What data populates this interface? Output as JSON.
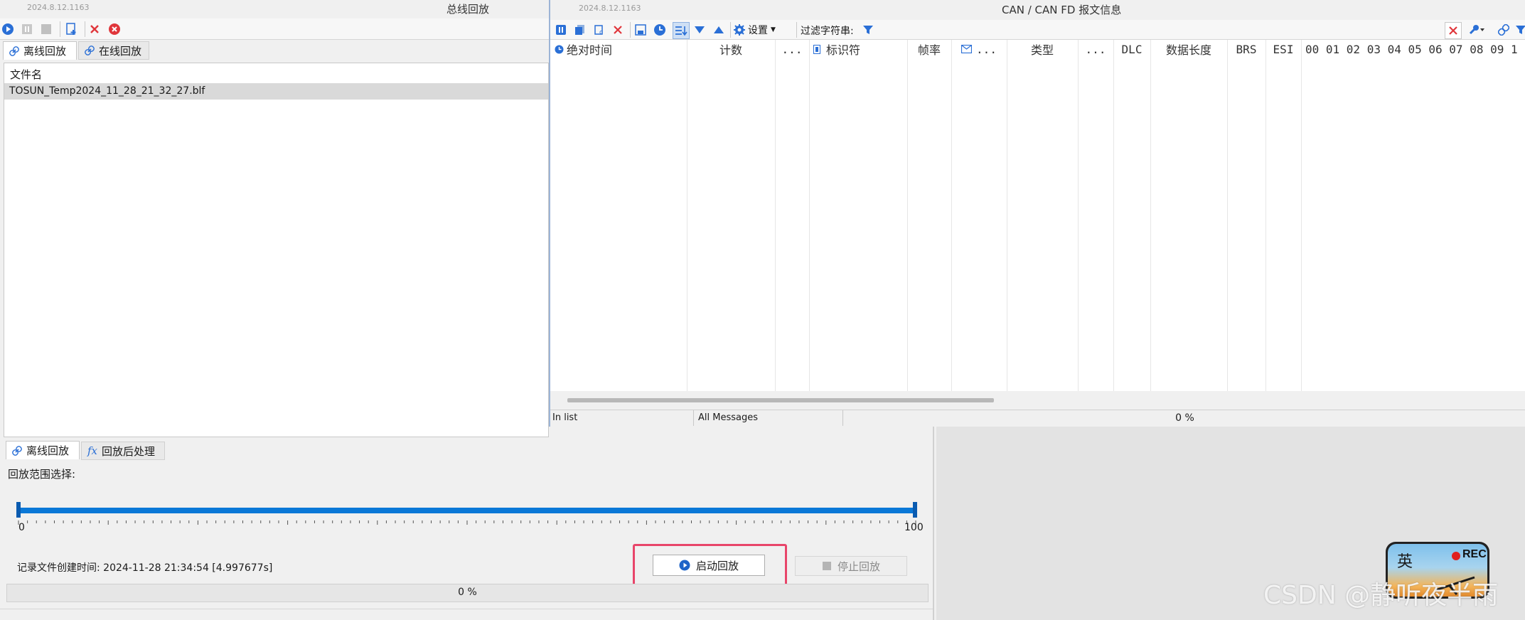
{
  "left_window": {
    "version": "2024.8.12.1163",
    "title": "总线回放",
    "tabs": [
      {
        "label": "离线回放",
        "active": true
      },
      {
        "label": "在线回放",
        "active": false
      }
    ],
    "file_list": {
      "header": "文件名",
      "rows": [
        {
          "name": "TOSUN_Temp2024_11_28_21_32_27.blf",
          "selected": true
        }
      ]
    },
    "bottom_tabs": [
      {
        "label": "离线回放",
        "active": true
      },
      {
        "label": "回放后处理",
        "active": false
      }
    ],
    "range_label": "回放范围选择:",
    "range": {
      "min": "0",
      "max": "100",
      "start_fraction": 0,
      "end_fraction": 1
    },
    "created_label": "记录文件创建时间: 2024-11-28 21:34:54 [4.997677s]",
    "start_button": "启动回放",
    "stop_button": "停止回放",
    "progress_text": "0 %",
    "progress_value": 0
  },
  "right_window": {
    "version": "2024.8.12.1163",
    "title": "CAN / CAN FD 报文信息",
    "toolbar": {
      "settings_label": "设置",
      "filter_label": "过滤字符串:"
    },
    "columns": [
      "绝对时间",
      "计数",
      "...",
      "标识符",
      "帧率",
      "...",
      "类型",
      "...",
      "DLC",
      "数据长度",
      "BRS",
      "ESI",
      "00 01 02 03 04 05 06 07 08 09 1"
    ],
    "status": {
      "in_list": "In list",
      "messages": "All Messages",
      "percent": "0 %"
    }
  },
  "watermark": "CSDN @静听夜半雨",
  "widget": {
    "rec_label": "REC",
    "glyph": "英"
  },
  "colors": {
    "accent": "#1e73d8",
    "highlight": "#e8456a",
    "selected_row": "#d9d9d9",
    "close_red": "#e0363b"
  }
}
